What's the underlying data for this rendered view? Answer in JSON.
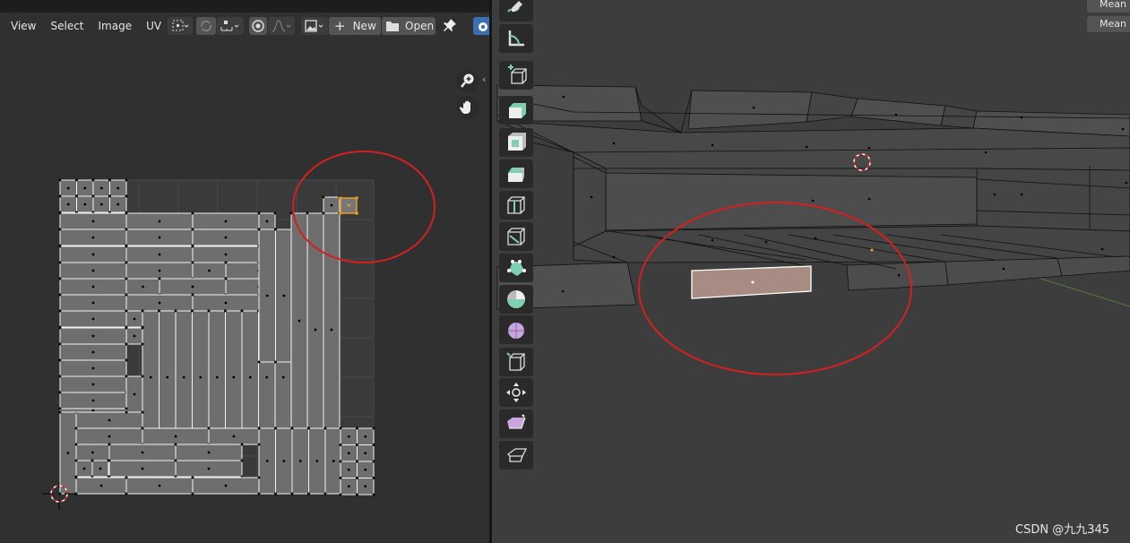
{
  "uv_editor": {
    "menu": [
      "View",
      "Select",
      "Image",
      "UV"
    ],
    "new_label": "New",
    "open_label": "Open"
  },
  "viewport": {
    "n_panel": [
      "Mean E",
      "Mean C"
    ]
  },
  "watermark": "CSDN @九九345",
  "colors": {
    "annotation_circle": "#d42020",
    "selected_face": "#e79a2b",
    "selected_mesh_face": "#a88c84",
    "grid_background": "#303030",
    "uv_face_fill": "#6e6e6e"
  },
  "icons": [
    "pivot-icon",
    "uv-sync-icon",
    "snap-icon",
    "proportional-icon",
    "falloff-icon",
    "image-browse-icon",
    "plus-icon",
    "folder-icon",
    "pin-icon",
    "zoom-icon",
    "pan-hand-icon"
  ]
}
